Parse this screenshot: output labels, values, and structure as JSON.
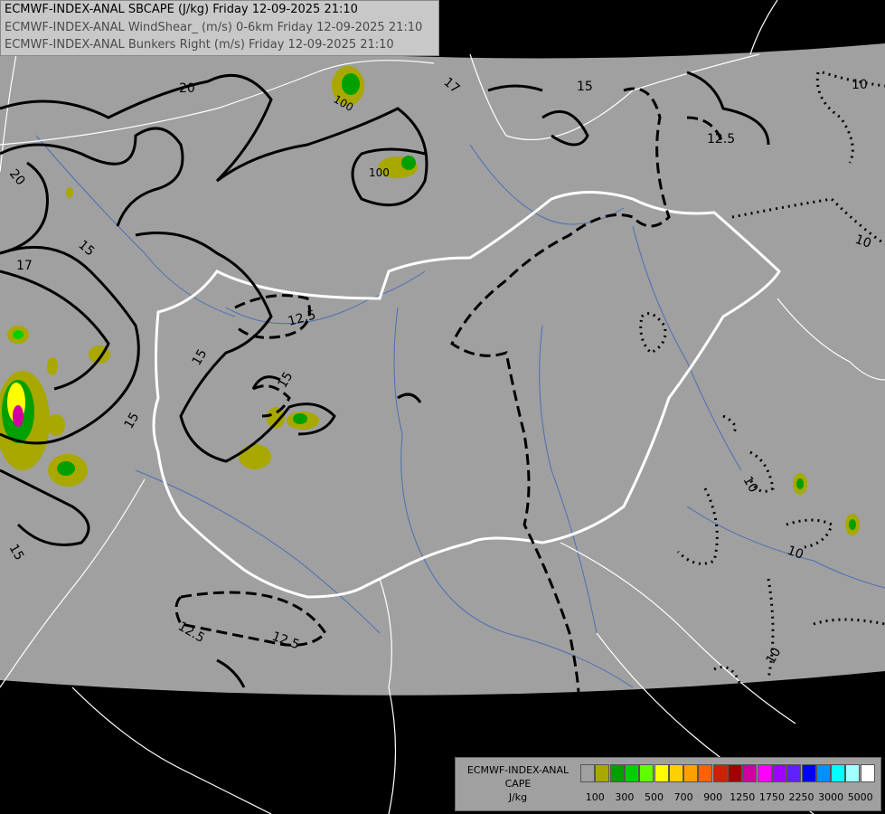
{
  "header": {
    "line1": "ECMWF-INDEX-ANAL SBCAPE (J/kg) Friday 12-09-2025 21:10",
    "line2": "ECMWF-INDEX-ANAL WindShear_ (m/s) 0-6km Friday 12-09-2025 21:10",
    "line3": "ECMWF-INDEX-ANAL Bunkers Right (m/s) Friday 12-09-2025 21:10"
  },
  "legend": {
    "title_line1": "ECMWF-INDEX-ANAL",
    "title_line2": "CAPE",
    "title_line3": "J/kg",
    "swatches": [
      "#a0a0a0",
      "#a8a800",
      "#00a000",
      "#00d000",
      "#60ff00",
      "#ffff00",
      "#ffd000",
      "#ffa000",
      "#ff6000",
      "#d02000",
      "#a00000",
      "#d000a0",
      "#ff00ff",
      "#a000ff",
      "#6020ff",
      "#0000ff",
      "#0090ff",
      "#00ffff",
      "#a0ffff",
      "#ffffff"
    ],
    "ticks": [
      "100",
      "300",
      "500",
      "700",
      "900",
      "1250",
      "1750",
      "2250",
      "3000",
      "5000"
    ]
  },
  "contour_labels": {
    "shear_20": "20",
    "shear_17": "17",
    "shear_15": "15",
    "shear_12_5": "12.5",
    "bunkers_10": "10",
    "cape_100": "100"
  },
  "colors": {
    "domain": "#a0a0a0",
    "outside": "#000000",
    "border": "#ffffff",
    "river": "#4a6fb5"
  }
}
